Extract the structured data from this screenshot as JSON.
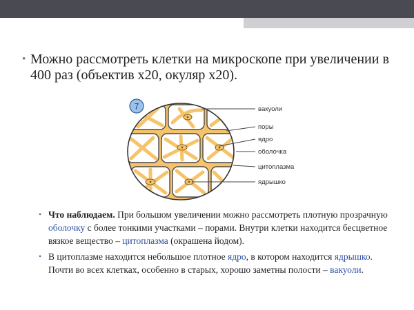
{
  "slide": {
    "bullet_glyph": "•",
    "main_text": "Можно рассмотреть клетки на микроскопе при увеличении в 400 раз (объектив х20, окуляр х20)."
  },
  "figure": {
    "number": "7",
    "labels": [
      "вакуоли",
      "поры",
      "ядро",
      "оболочка",
      "цитоплазма",
      "ядрышко"
    ]
  },
  "points": {
    "p1": {
      "lead": "Что наблюдаем.",
      "t1": " При большом увеличении можно рассмотреть плотную прозрачную ",
      "term1": "оболочку",
      "t2": " с более тонкими участками – порами. Внутри клетки находится бесцветное вязкое вещество – ",
      "term2": "цитоплазма",
      "t3": " (окрашена йодом)."
    },
    "p2": {
      "t1": "В цитоплазме находится небольшое плотное ",
      "term1": "ядро",
      "t2": ", в котором находится ",
      "term2": "ядрышко",
      "t3": ". Почти во всех клетках, особенно в старых, хорошо заметны полости – ",
      "term3": "вакуоли",
      "t4": "."
    }
  },
  "colors": {
    "topbar": "#4a4a52",
    "accentbar": "#cfcfd4",
    "cytoplasm": "#f6c36a",
    "term": "#2e4fa0",
    "bullet": "#7a64a0"
  }
}
